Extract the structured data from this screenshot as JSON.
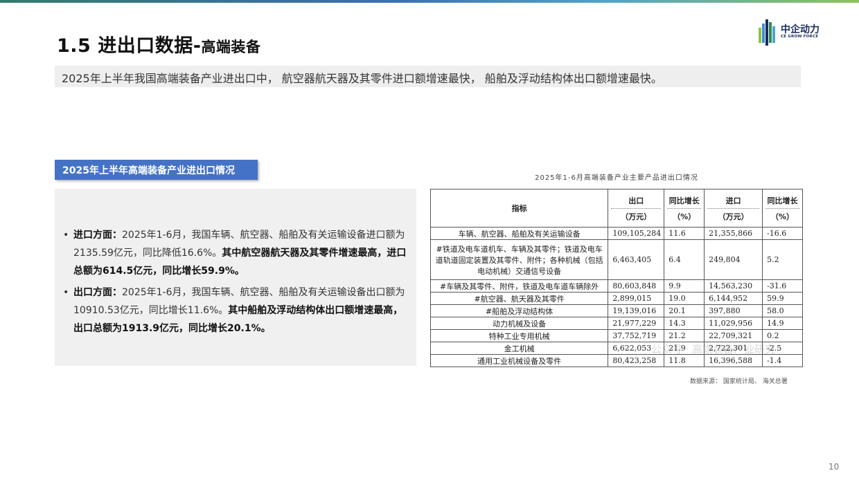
{
  "header": {
    "title": "1.5 进出口数据-",
    "title_sub": "高端装备",
    "logo_cn": "中企动力",
    "logo_en": "CE GROW FORCE"
  },
  "summary": "2025年上半年我国高端装备产业进出口中， 航空器航天器及其零件进口额增速最快， 船舶及浮动结构体出口额增速最快。",
  "section_tag": "2025年上半年高端装备产业进出口情况",
  "bullets": [
    {
      "label": "进口方面：",
      "text": "2025年1-6月，我国车辆、航空器、船舶及有关运输设备进口额为2135.59亿元，同比降低16.6%。",
      "bold": "其中航空器航天器及其零件增速最高，进口总额为614.5亿元，同比增长59.9%。"
    },
    {
      "label": "出口方面：",
      "text": "2025年1-6月，我国车辆、航空器、船舶及有关运输设备出口额为10910.53亿元，同比增长11.6%。",
      "bold": "其中船舶及浮动结构体出口额增速最高，出口总额为1913.9亿元，同比增长20.1%。"
    }
  ],
  "table": {
    "title": "2025年1-6月高端装备产业主要产品进出口情况",
    "headers": {
      "indicator": "指标",
      "export": "出口",
      "export_unit": "（万元）",
      "export_yoy": "同比增长",
      "export_yoy_unit": "（%）",
      "import": "进口",
      "import_unit": "（万元）",
      "import_yoy": "同比增长",
      "import_yoy_unit": "（%）"
    },
    "rows": [
      {
        "name": "车辆、航空器、船舶及有关运输设备",
        "export": "109,105,284",
        "export_yoy": "11.6",
        "import": "21,355,866",
        "import_yoy": "-16.6"
      },
      {
        "name": "#铁道及电车道机车、车辆及其零件；铁道及电车道轨道固定装置及其零件、附件；各种机械（包括电动机械）交通信号设备",
        "export": "6,463,405",
        "export_yoy": "6.4",
        "import": "249,804",
        "import_yoy": "5.2"
      },
      {
        "name": "#车辆及其零件、附件，铁道及电车道车辆除外",
        "export": "80,603,848",
        "export_yoy": "9.9",
        "import": "14,563,230",
        "import_yoy": "-31.6"
      },
      {
        "name": "#航空器、航天器及其零件",
        "export": "2,899,015",
        "export_yoy": "19.0",
        "import": "6,144,952",
        "import_yoy": "59.9"
      },
      {
        "name": "#船舶及浮动结构体",
        "export": "19,139,016",
        "export_yoy": "20.1",
        "import": "397,880",
        "import_yoy": "58.0"
      },
      {
        "name": "动力机械及设备",
        "export": "21,977,229",
        "export_yoy": "14.3",
        "import": "11,029,956",
        "import_yoy": "14.9"
      },
      {
        "name": "特种工业专用机械",
        "export": "37,752,719",
        "export_yoy": "21.2",
        "import": "22,709,321",
        "import_yoy": "0.2"
      },
      {
        "name": "金工机械",
        "export": "6,622,053",
        "export_yoy": "21.9",
        "import": "2,722,301",
        "import_yoy": "-2.5"
      },
      {
        "name": "通用工业机械设备及零件",
        "export": "80,423,258",
        "export_yoy": "11.8",
        "import": "16,396,588",
        "import_yoy": "-1.4"
      }
    ],
    "source": "数据来源： 国家统计局、 海关总署",
    "watermark": "公众号 · 高端装备产业研究"
  },
  "page_number": "10",
  "colors": {
    "accent_blue": "#4472c4",
    "summary_bg": "#eeeeee",
    "logo_navy": "#1c2b5a"
  }
}
